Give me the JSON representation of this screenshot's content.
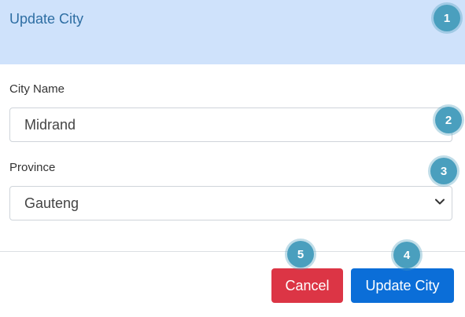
{
  "colors": {
    "header_bg": "#cfe2fb",
    "header_text": "#2e6ea3",
    "cancel_bg": "#dc3545",
    "primary_bg": "#0b6ed8",
    "badge_bg": "#4a9fbe"
  },
  "header": {
    "title": "Update City"
  },
  "form": {
    "city_name": {
      "label": "City Name",
      "value": "Midrand"
    },
    "province": {
      "label": "Province",
      "selected": "Gauteng",
      "icon": "chevron-down-icon"
    }
  },
  "footer": {
    "cancel_label": "Cancel",
    "update_label": "Update City"
  },
  "callouts": [
    "1",
    "2",
    "3",
    "4",
    "5"
  ]
}
